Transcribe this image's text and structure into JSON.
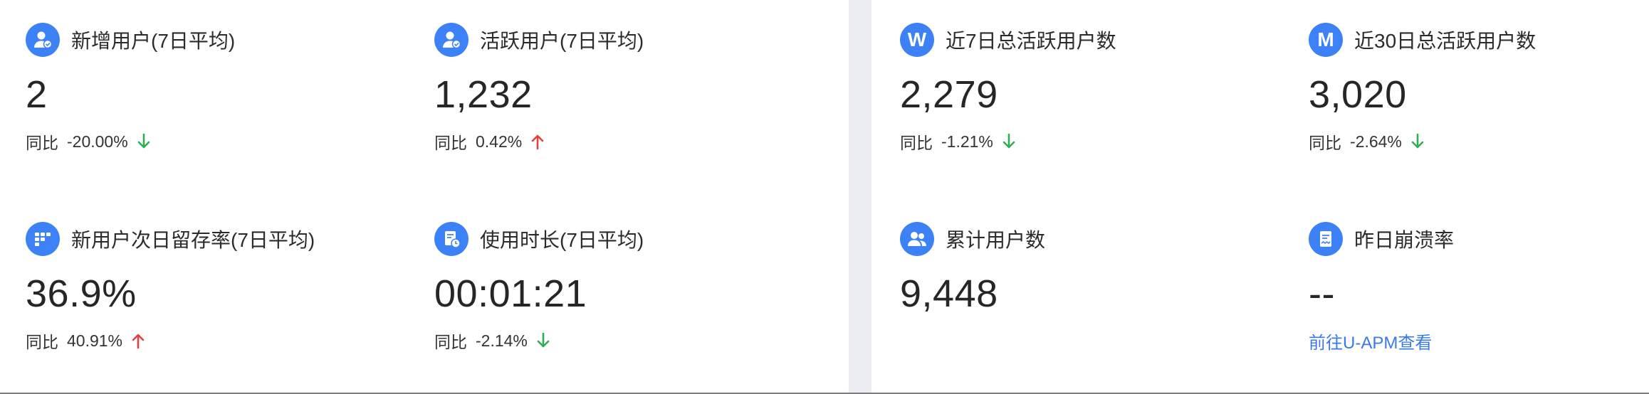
{
  "colors": {
    "accent": "#3c82f6",
    "up": "#e34141",
    "down": "#2fae54",
    "link": "#3a7ae8"
  },
  "left_panel": {
    "cards": [
      {
        "icon": "user-check-icon",
        "title": "新增用户(7日平均)",
        "value": "2",
        "cmp_label": "同比",
        "cmp_value": "-20.00%",
        "trend": "down"
      },
      {
        "icon": "user-check-icon",
        "title": "活跃用户(7日平均)",
        "value": "1,232",
        "cmp_label": "同比",
        "cmp_value": "0.42%",
        "trend": "up"
      },
      {
        "icon": "grid-icon",
        "title": "新用户次日留存率(7日平均)",
        "value": "36.9%",
        "cmp_label": "同比",
        "cmp_value": "40.91%",
        "trend": "up"
      },
      {
        "icon": "clock-doc-icon",
        "title": "使用时长(7日平均)",
        "value": "00:01:21",
        "cmp_label": "同比",
        "cmp_value": "-2.14%",
        "trend": "down"
      }
    ]
  },
  "right_panel": {
    "cards": [
      {
        "icon_letter": "W",
        "title": "近7日总活跃用户数",
        "value": "2,279",
        "cmp_label": "同比",
        "cmp_value": "-1.21%",
        "trend": "down"
      },
      {
        "icon_letter": "M",
        "title": "近30日总活跃用户数",
        "value": "3,020",
        "cmp_label": "同比",
        "cmp_value": "-2.64%",
        "trend": "down"
      },
      {
        "icon": "users-icon",
        "title": "累计用户数",
        "value": "9,448"
      },
      {
        "icon": "crash-report-icon",
        "title": "昨日崩溃率",
        "value": "--",
        "link": "前往U-APM查看"
      }
    ]
  }
}
